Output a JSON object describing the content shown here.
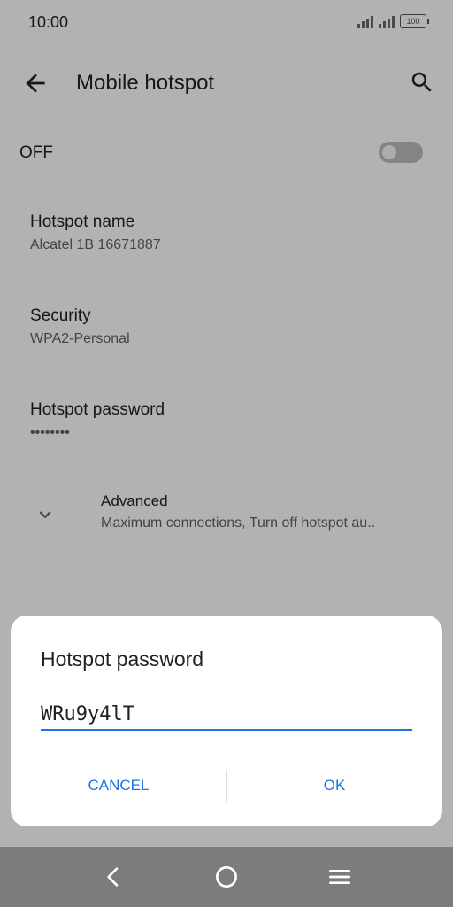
{
  "status_bar": {
    "time": "10:00",
    "battery": "100"
  },
  "app_bar": {
    "title": "Mobile hotspot",
    "back_icon": "arrow-back-icon",
    "search_icon": "search-icon"
  },
  "hotspot_toggle": {
    "label": "OFF",
    "state": "off"
  },
  "settings": [
    {
      "title": "Hotspot name",
      "subtitle": "Alcatel 1B 16671887"
    },
    {
      "title": "Security",
      "subtitle": "WPA2-Personal"
    },
    {
      "title": "Hotspot password",
      "subtitle": "••••••••"
    }
  ],
  "advanced": {
    "title": "Advanced",
    "subtitle": "Maximum connections, Turn off hotspot au.."
  },
  "dialog": {
    "title": "Hotspot password",
    "password_value": "WRu9y4lT",
    "cancel_label": "CANCEL",
    "ok_label": "OK"
  },
  "colors": {
    "accent": "#1a73e8",
    "scrim": "rgba(0,0,0,0.30)"
  }
}
